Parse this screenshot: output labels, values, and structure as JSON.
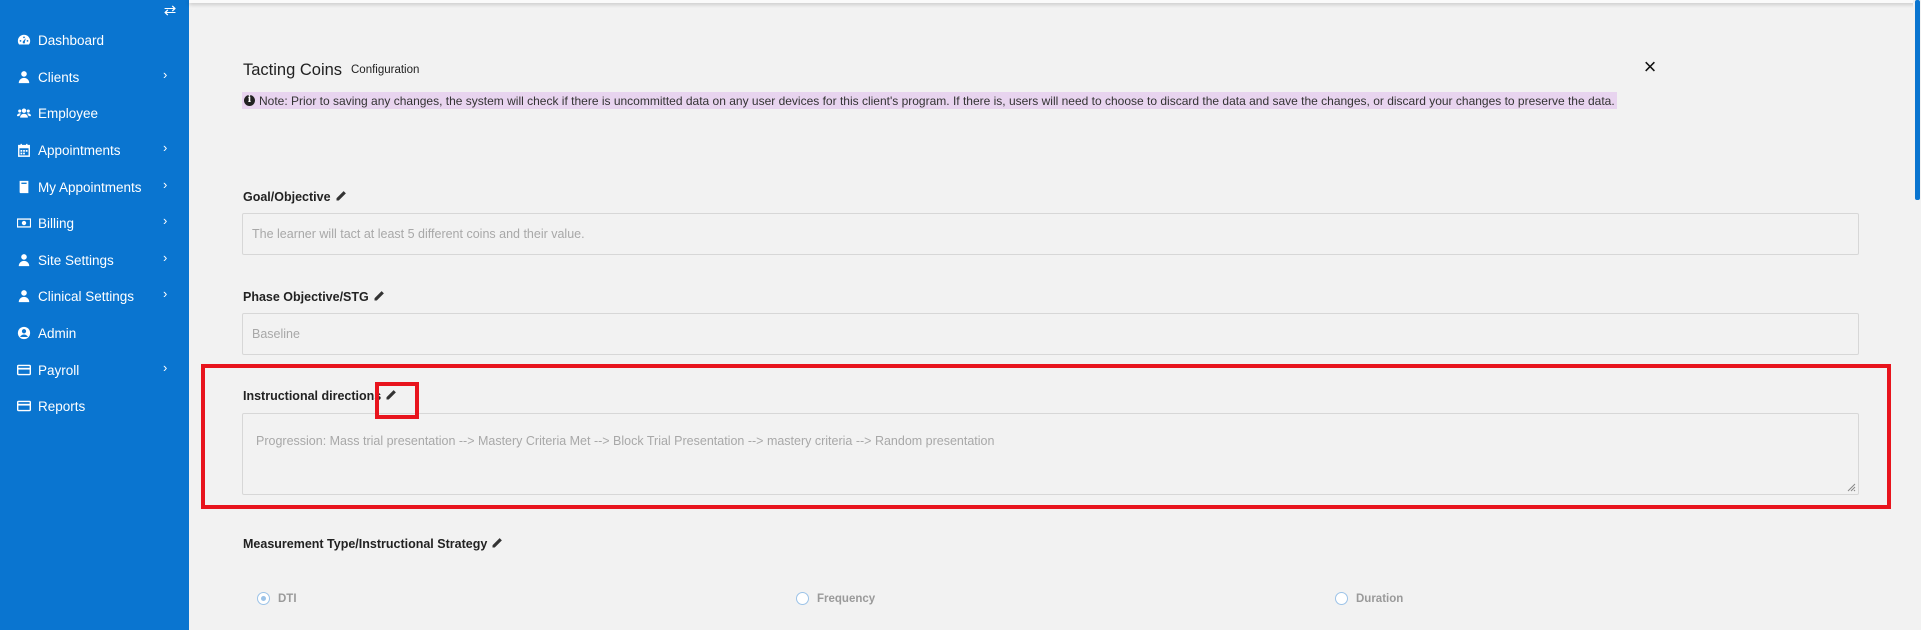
{
  "sidebar": {
    "items": [
      {
        "label": "Dashboard",
        "icon": "dashboard-icon",
        "has_submenu": false
      },
      {
        "label": "Clients",
        "icon": "user-icon",
        "has_submenu": true
      },
      {
        "label": "Employee",
        "icon": "users-icon",
        "has_submenu": false
      },
      {
        "label": "Appointments",
        "icon": "calendar-icon",
        "has_submenu": true
      },
      {
        "label": "My Appointments",
        "icon": "book-icon",
        "has_submenu": true
      },
      {
        "label": "Billing",
        "icon": "money-icon",
        "has_submenu": true
      },
      {
        "label": "Site Settings",
        "icon": "user-icon",
        "has_submenu": true
      },
      {
        "label": "Clinical Settings",
        "icon": "user-icon",
        "has_submenu": true
      },
      {
        "label": "Admin",
        "icon": "user-circle-icon",
        "has_submenu": false
      },
      {
        "label": "Payroll",
        "icon": "credit-card-icon",
        "has_submenu": true
      },
      {
        "label": "Reports",
        "icon": "credit-card-icon",
        "has_submenu": false
      }
    ]
  },
  "modal": {
    "title": "Tacting Coins",
    "subtitle": "Configuration",
    "note": "Note: Prior to saving any changes, the system will check if there is uncommitted data on any user devices for this client's program. If there is, users will need to choose to discard the data and save the changes, or discard your changes to preserve the data.",
    "fields": {
      "goal": {
        "label": "Goal/Objective",
        "value": "The learner will tact at least 5 different coins and their value."
      },
      "phase": {
        "label": "Phase Objective/STG",
        "value": "Baseline"
      },
      "instructions": {
        "label": "Instructional directions",
        "value": "Progression: Mass trial presentation --> Mastery Criteria Met --> Block Trial Presentation --> mastery criteria --> Random presentation"
      }
    },
    "measurement": {
      "label": "Measurement Type/Instructional Strategy",
      "options": [
        "DTI",
        "Frequency",
        "Duration"
      ],
      "selected": "DTI"
    }
  },
  "colors": {
    "sidebar": "#0a75d0",
    "note_bg": "#e8d4ef",
    "highlight": "#e8141d"
  }
}
